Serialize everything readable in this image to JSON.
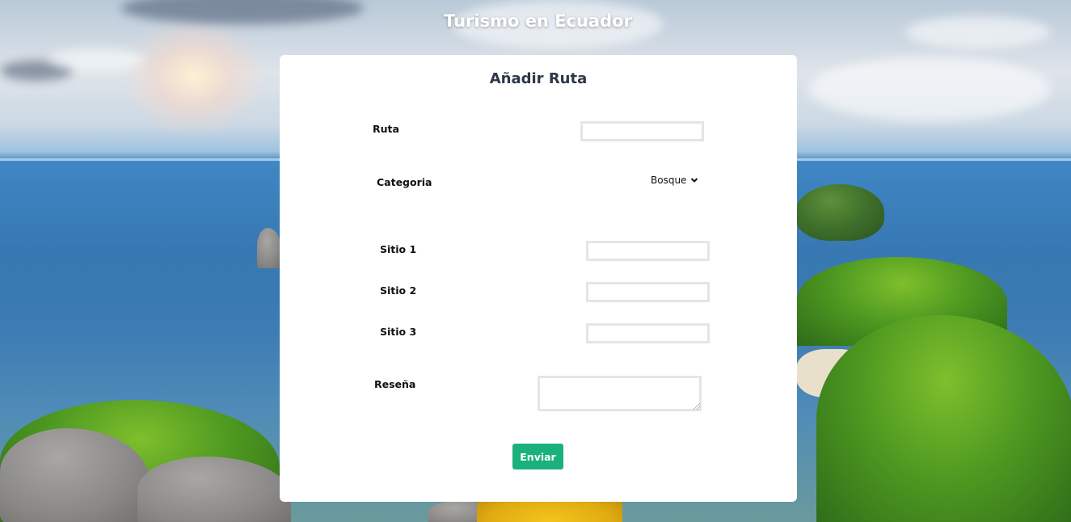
{
  "header": {
    "title": "Turismo en Ecuador"
  },
  "form": {
    "title": "Añadir Ruta",
    "labels": {
      "ruta": "Ruta",
      "categoria": "Categoria",
      "sitio1": "Sitio 1",
      "sitio2": "Sitio 2",
      "sitio3": "Sitio 3",
      "resena": "Reseña"
    },
    "values": {
      "ruta": "",
      "categoria": "Bosque",
      "sitio1": "",
      "sitio2": "",
      "sitio3": "",
      "resena": ""
    },
    "submit_label": "Enviar"
  },
  "colors": {
    "submit_button": "#1ab17b",
    "card_background": "#ffffff",
    "title_text": "#2d3748"
  },
  "icons": {
    "select_chevron": "chevron-down-icon"
  }
}
